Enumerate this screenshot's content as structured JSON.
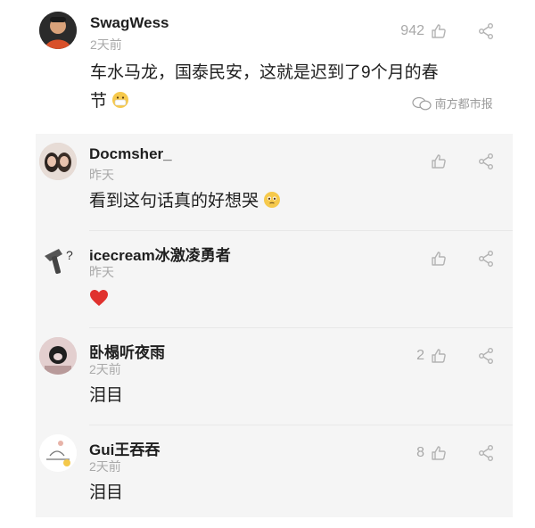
{
  "main_comment": {
    "user": "SwagWess",
    "time": "2天前",
    "likes": "942",
    "text_line1": "车水马龙，国泰民安，这就是迟到了9个月的春",
    "text_line2": "节"
  },
  "watermark": "南方都市报",
  "replies": [
    {
      "user": "Docmsher_",
      "time": "昨天",
      "likes": "",
      "text": "看到这句话真的好想哭"
    },
    {
      "user": "icecream冰激凌勇者",
      "time": "昨天",
      "likes": "",
      "text": ""
    },
    {
      "user": "卧榻听夜雨",
      "time": "2天前",
      "likes": "2",
      "text": "泪目"
    },
    {
      "user": "Gui王吞吞",
      "time": "2天前",
      "likes": "8",
      "text": "泪目"
    }
  ],
  "colors": {
    "heart": "#e0322e",
    "muted": "#a9a9a9",
    "reply_bg": "#f5f5f5"
  }
}
